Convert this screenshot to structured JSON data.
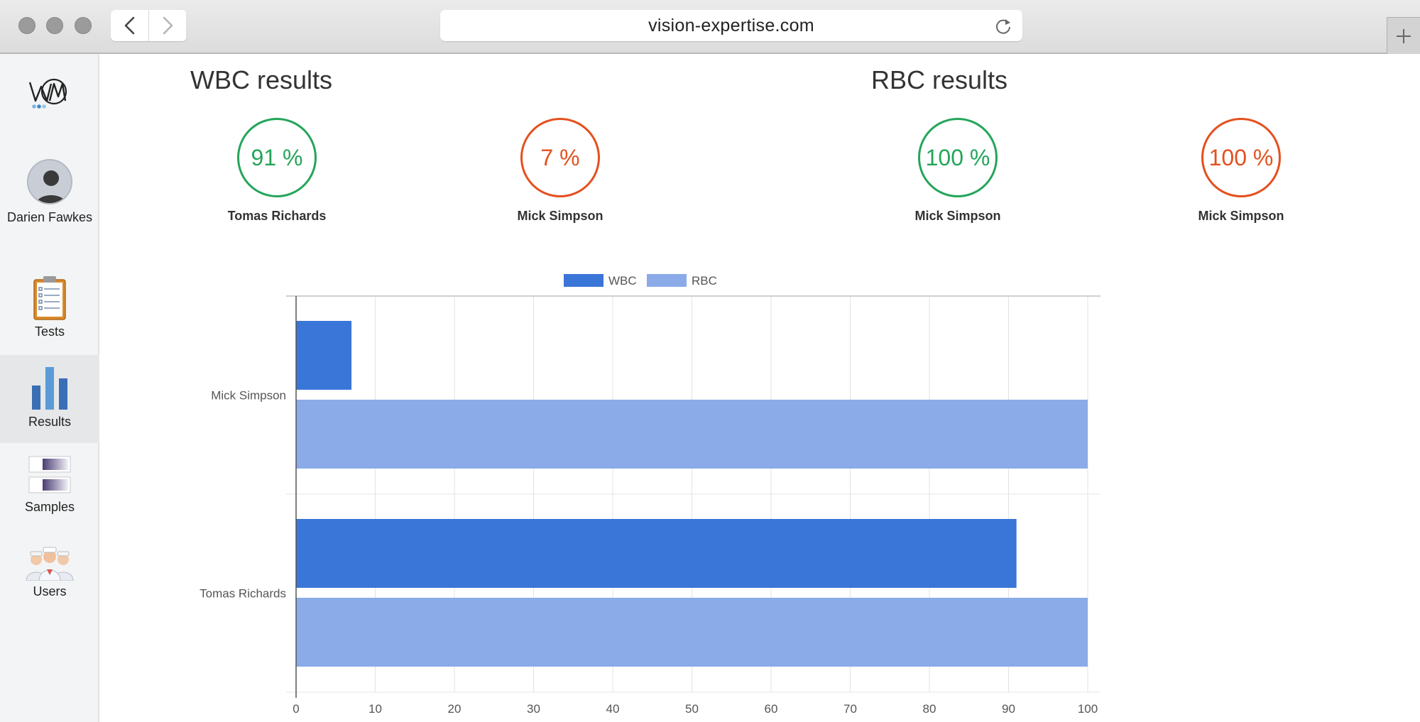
{
  "browser": {
    "url": "vision-expertise.com"
  },
  "sidebar": {
    "user_name": "Darien Fawkes",
    "items": [
      {
        "label": "Tests",
        "icon": "clipboard-icon"
      },
      {
        "label": "Results",
        "icon": "bar-chart-icon",
        "active": true
      },
      {
        "label": "Samples",
        "icon": "samples-icon"
      },
      {
        "label": "Users",
        "icon": "users-icon"
      }
    ]
  },
  "wbc": {
    "title": "WBC results",
    "gauges": [
      {
        "value": "91 %",
        "name": "Tomas Richards",
        "status": "good"
      },
      {
        "value": "7 %",
        "name": "Mick Simpson",
        "status": "bad"
      }
    ]
  },
  "rbc": {
    "title": "RBC results",
    "gauges": [
      {
        "value": "100 %",
        "name": "Mick Simpson",
        "status": "good"
      },
      {
        "value": "100 %",
        "name": "Mick Simpson",
        "status": "bad"
      }
    ]
  },
  "colors": {
    "good": "#25a55a",
    "bad": "#e4501e",
    "wbc": "#3a76d8",
    "rbc": "#8aabe8"
  },
  "chart_data": {
    "type": "bar",
    "orientation": "horizontal",
    "categories": [
      "Mick Simpson",
      "Tomas Richards"
    ],
    "series": [
      {
        "name": "WBC",
        "values": [
          7,
          91
        ],
        "color": "#3a76d8"
      },
      {
        "name": "RBC",
        "values": [
          100,
          100
        ],
        "color": "#8aabe8"
      }
    ],
    "xlim": [
      0,
      100
    ],
    "xticks": [
      0,
      10,
      20,
      30,
      40,
      50,
      60,
      70,
      80,
      90,
      100
    ],
    "grid": true,
    "legend": "top-center"
  }
}
